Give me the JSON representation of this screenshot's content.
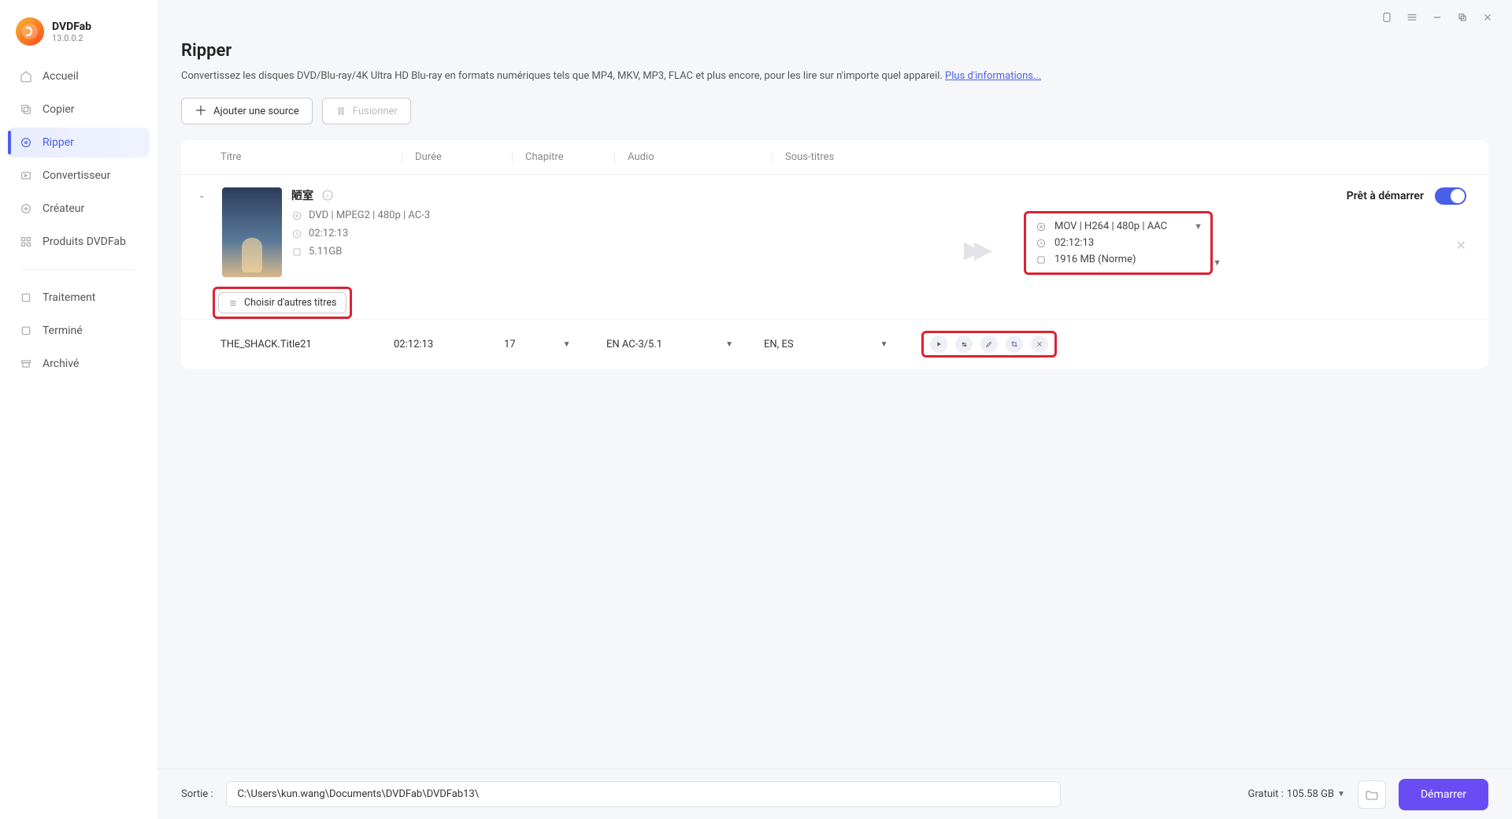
{
  "brand": {
    "name": "DVDFab",
    "version": "13.0.0.2"
  },
  "nav": {
    "accueil": "Accueil",
    "copier": "Copier",
    "ripper": "Ripper",
    "convertisseur": "Convertisseur",
    "createur": "Créateur",
    "produits": "Produits DVDFab",
    "traitement": "Traitement",
    "termine": "Terminé",
    "archive": "Archivé"
  },
  "page": {
    "title": "Ripper",
    "desc": "Convertissez les disques DVD/Blu-ray/4K Ultra HD Blu-ray en formats numériques tels que MP4, MKV, MP3, FLAC et plus encore, pour les lire sur n'importe quel appareil. ",
    "more": "Plus d'informations..."
  },
  "buttons": {
    "add_source": "Ajouter une source",
    "merge": "Fusionner",
    "choose_titles": "Choisir d'autres titres",
    "start": "Démarrer"
  },
  "columns": {
    "titre": "Titre",
    "duree": "Durée",
    "chapitre": "Chapitre",
    "audio": "Audio",
    "sous_titres": "Sous-titres"
  },
  "source": {
    "name": "陋室",
    "format_line": "DVD | MPEG2 | 480p | AC-3",
    "duration": "02:12:13",
    "size": "5.11GB",
    "ready_label": "Prêt à démarrer"
  },
  "output": {
    "format_line": "MOV | H264 | 480p | AAC",
    "duration": "02:12:13",
    "size": "1916 MB (Norme)"
  },
  "title_row": {
    "name": "THE_SHACK.Title21",
    "duration": "02:12:13",
    "chapter": "17",
    "audio": "EN  AC-3/5.1",
    "subs": "EN, ES"
  },
  "footer": {
    "label": "Sortie :",
    "path": "C:\\Users\\kun.wang\\Documents\\DVDFab\\DVDFab13\\",
    "free_label": "Gratuit : ",
    "free_value": "105.58 GB"
  }
}
